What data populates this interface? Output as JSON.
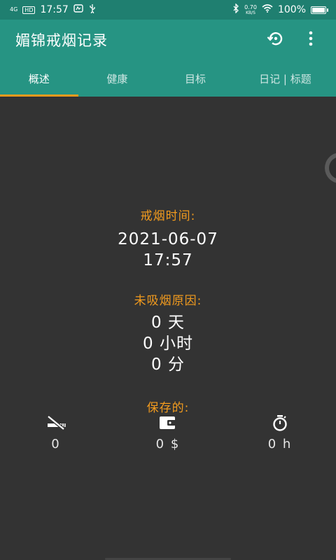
{
  "status_bar": {
    "network": "4G",
    "hd": "HD",
    "time": "17:57",
    "speed": "0.70",
    "speed_unit": "KB/S",
    "battery": "100%"
  },
  "app": {
    "title": "媚锦戒烟记录"
  },
  "tabs": [
    {
      "label": "概述",
      "active": true
    },
    {
      "label": "健康"
    },
    {
      "label": "目标"
    },
    {
      "label": "日记 | 标题"
    }
  ],
  "quit_time": {
    "label": "戒烟时间:",
    "date": "2021-06-07",
    "time": "17:57"
  },
  "duration": {
    "label": "未吸烟原因:",
    "days": "0 天",
    "hours": "0 小时",
    "minutes": "0 分"
  },
  "saved": {
    "label": "保存的:",
    "items": [
      {
        "icon": "no-smoking-icon",
        "value": "0"
      },
      {
        "icon": "wallet-icon",
        "value": "0 $"
      },
      {
        "icon": "stopwatch-icon",
        "value": "0 h"
      }
    ]
  },
  "colors": {
    "statusbar": "#1f7f70",
    "appbar": "#269483",
    "accent": "#f29b1e",
    "background": "#333333"
  }
}
